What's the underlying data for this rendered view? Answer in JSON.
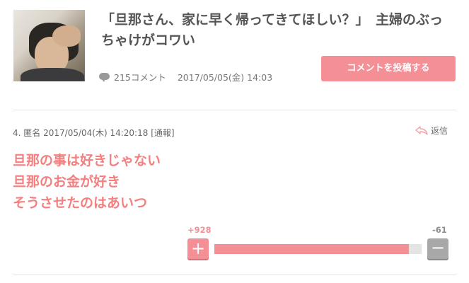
{
  "article": {
    "title": "「旦那さん、家に早く帰ってきてほしい？」　主婦のぶっちゃけがコワい",
    "comment_count": "215コメント",
    "date": "2017/05/05(金) 14:03",
    "post_button": "コメントを投稿する"
  },
  "comment": {
    "number": "4.",
    "name": "匿名",
    "datetime": "2017/05/04(木) 14:20:18",
    "report": "[通報]",
    "reply_label": "返信",
    "lines": [
      "旦那の事は好きじゃない",
      "旦那のお金が好き",
      "そうさせたのはあいつ"
    ],
    "plus": "+928",
    "minus": "-61",
    "plus_ratio": 0.938
  },
  "colors": {
    "accent": "#f48f96",
    "comment_text": "#f47f7f",
    "minus": "#a8a8a8"
  }
}
